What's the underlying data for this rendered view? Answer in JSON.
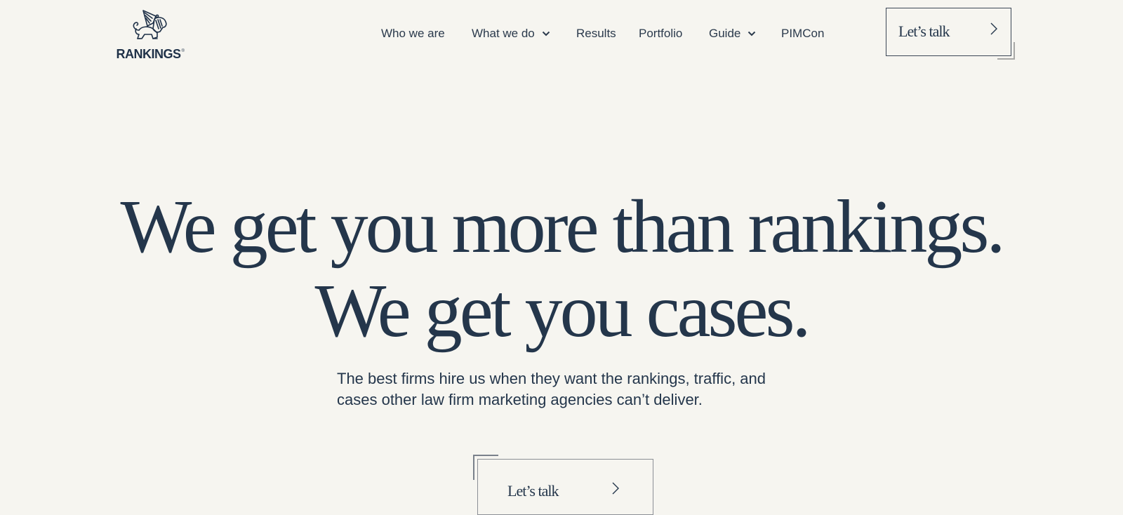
{
  "brand": {
    "name": "RANKINGS",
    "registered_mark": "®",
    "logo_icon": "winged-lion-icon"
  },
  "nav": {
    "items": [
      {
        "label": "Who we are",
        "has_dropdown": false
      },
      {
        "label": "What we do",
        "has_dropdown": true
      },
      {
        "label": "Results",
        "has_dropdown": false
      },
      {
        "label": "Portfolio",
        "has_dropdown": false
      },
      {
        "label": "Guide",
        "has_dropdown": true
      },
      {
        "label": "PIMCon",
        "has_dropdown": false
      }
    ],
    "dropdown_icon": "chevron-down-icon"
  },
  "header_cta": {
    "label": "Let’s talk",
    "icon": "chevron-right-icon"
  },
  "hero": {
    "headline_line1": "We get you more than rankings.",
    "headline_line2": "We get you cases.",
    "subtext": "The best firms hire us when they want the rankings, traffic, and cases other law firm marketing agencies can’t deliver.",
    "cta": {
      "label": "Let’s talk",
      "icon": "chevron-right-icon"
    }
  },
  "colors": {
    "background": "#f6f5f0",
    "text_primary": "#24364b",
    "border": "#3c4756",
    "accent_bracket": "#a8a8a6"
  }
}
